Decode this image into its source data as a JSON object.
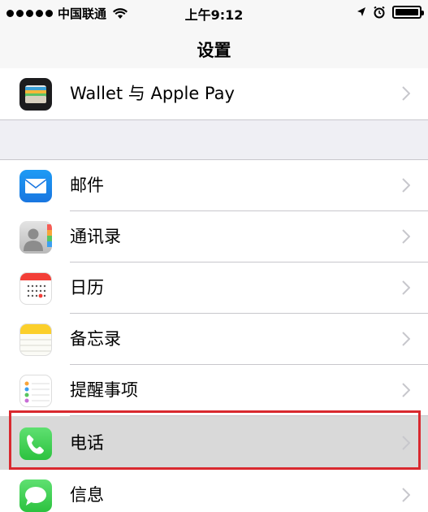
{
  "status_bar": {
    "carrier": "中国联通",
    "time": "上午9:12"
  },
  "nav": {
    "title": "设置"
  },
  "rows_top": [
    {
      "label": "Wallet 与 Apple Pay",
      "icon": "wallet-icon"
    }
  ],
  "rows": [
    {
      "label": "邮件",
      "icon": "mail-icon"
    },
    {
      "label": "通讯录",
      "icon": "contacts-icon"
    },
    {
      "label": "日历",
      "icon": "calendar-icon"
    },
    {
      "label": "备忘录",
      "icon": "notes-icon"
    },
    {
      "label": "提醒事项",
      "icon": "reminders-icon"
    },
    {
      "label": "电话",
      "icon": "phone-icon",
      "selected": true
    },
    {
      "label": "信息",
      "icon": "messages-icon"
    }
  ],
  "colors": {
    "highlight": "#d9292f",
    "separator": "#c8c7cc",
    "background": "#efeff4"
  }
}
